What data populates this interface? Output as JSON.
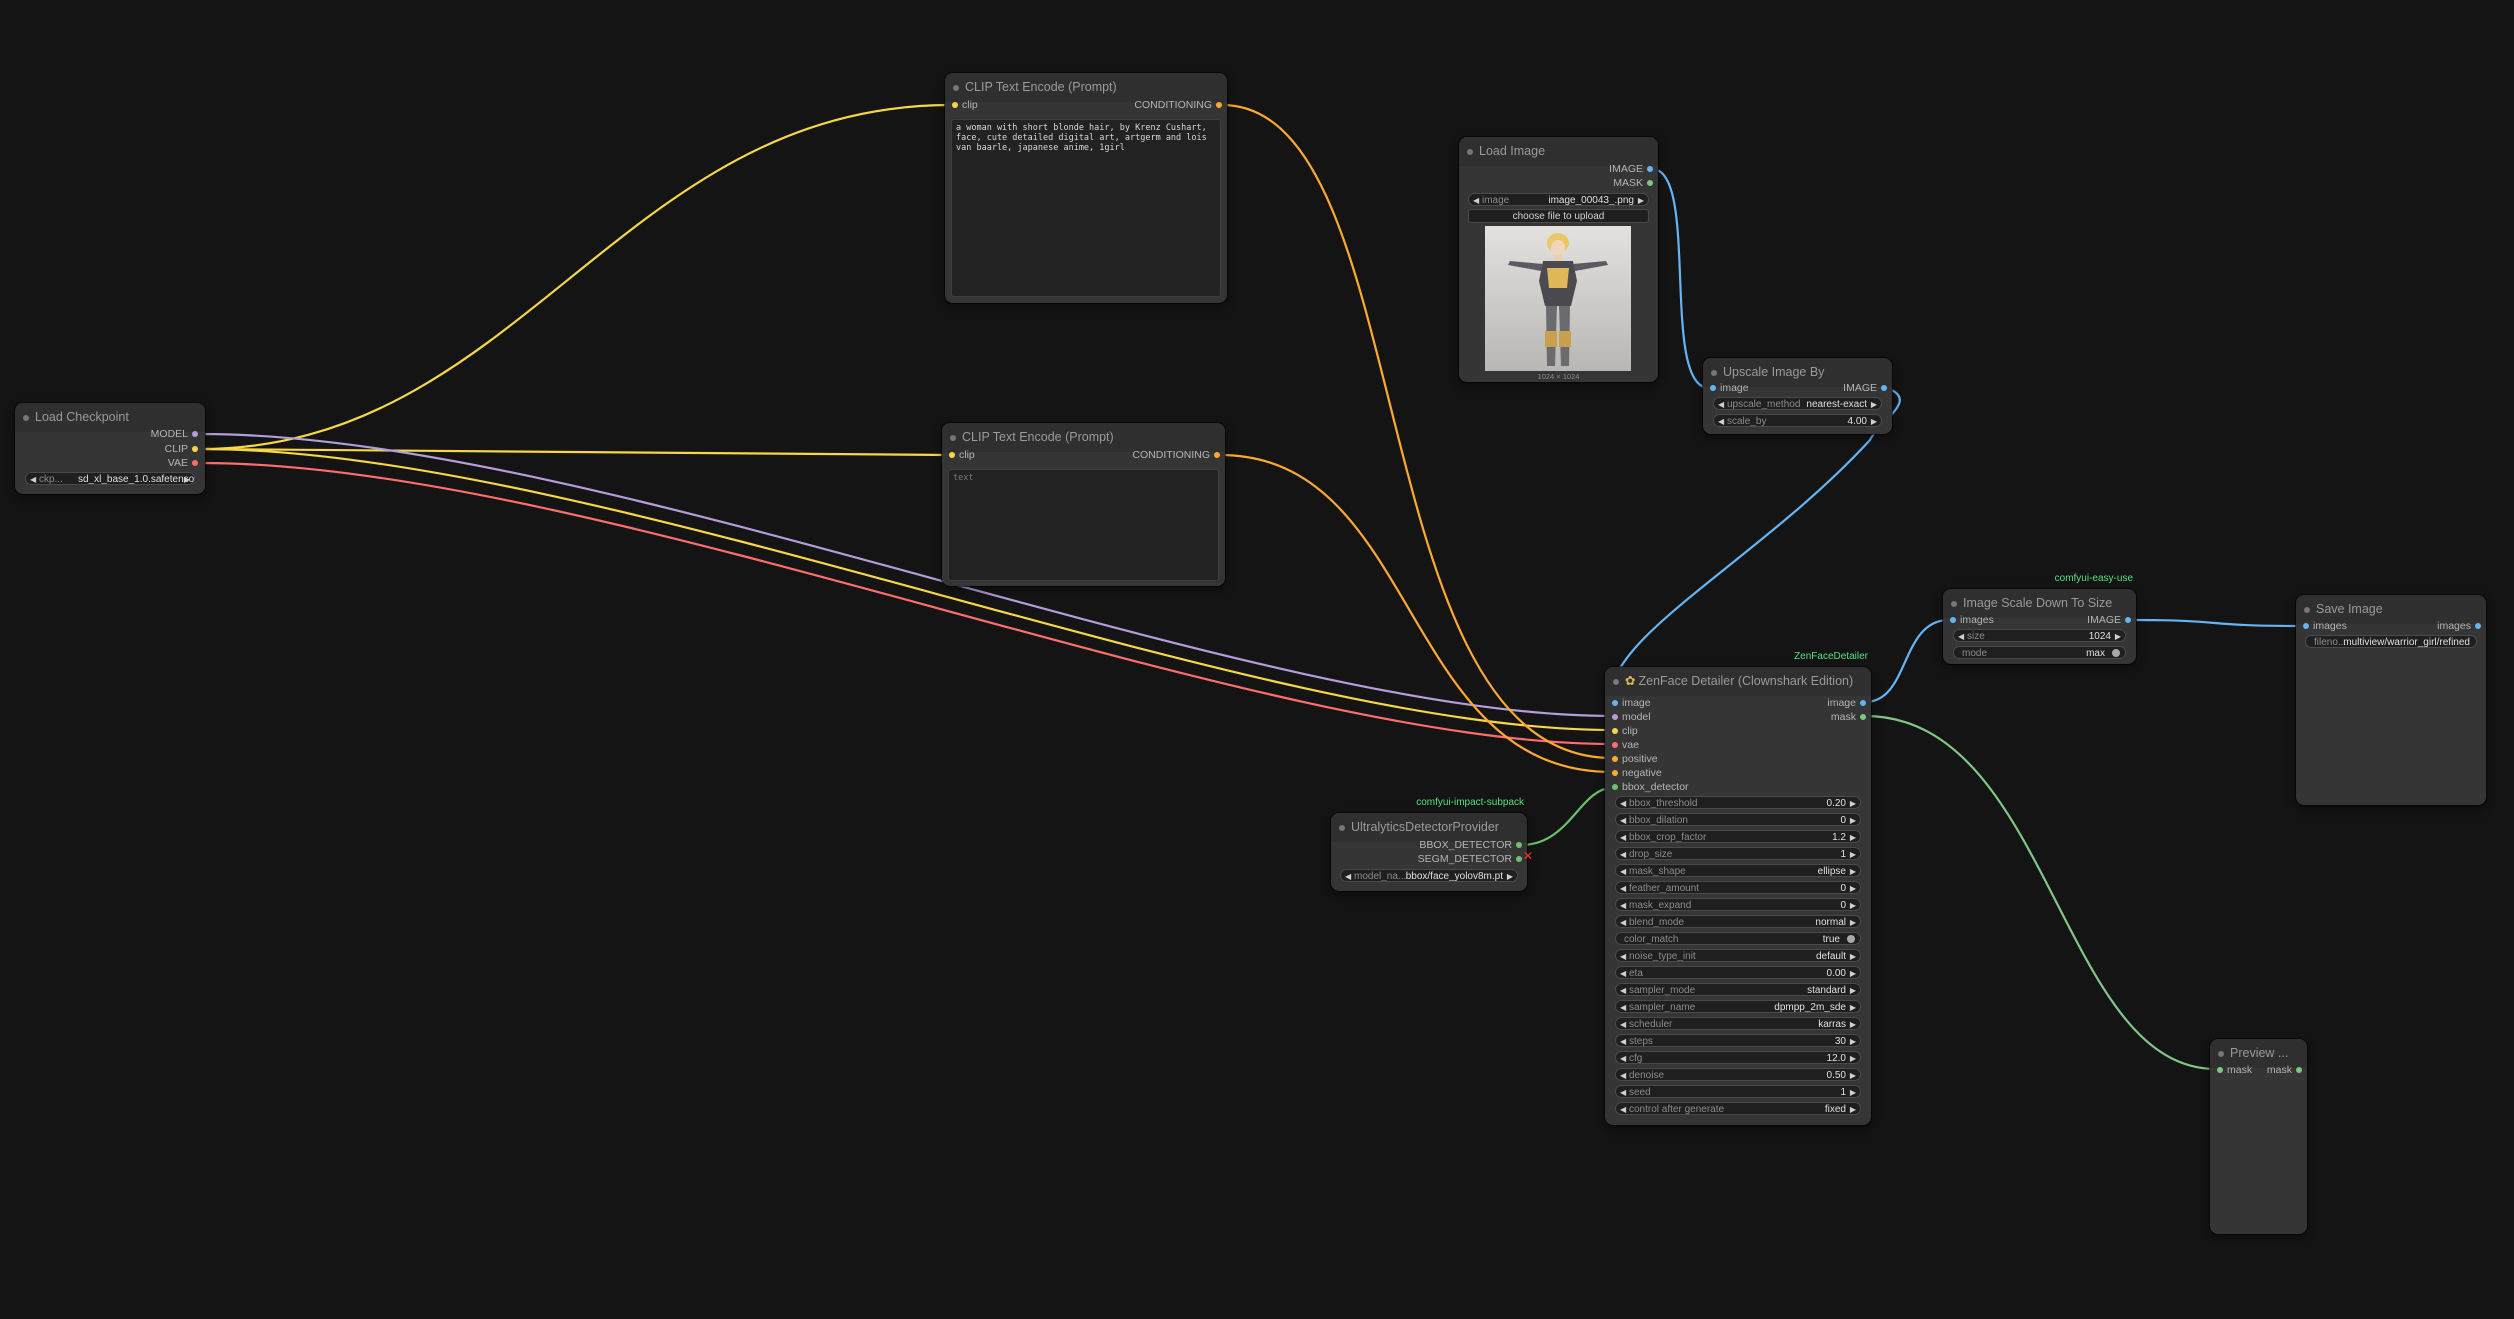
{
  "colors": {
    "clip": "#f7d648",
    "model": "#b39ddb",
    "vae": "#ff6e6e",
    "conditioning": "#ffa931",
    "image": "#64b5f6",
    "mask": "#81c784",
    "bbox": "#6cc16c",
    "badge": "#55e07b"
  },
  "load_checkpoint": {
    "title": "Load Checkpoint",
    "outputs": [
      "MODEL",
      "CLIP",
      "VAE"
    ],
    "ckpt_name": "ckp...",
    "ckpt_value": "sd_xl_base_1.0.safetensors"
  },
  "clip_encode_1": {
    "title": "CLIP Text Encode (Prompt)",
    "input": "clip",
    "output": "CONDITIONING",
    "text": "a woman with short blonde hair, by Krenz Cushart, face, cute detailed digital art, artgerm and lois van baarle, japanese anime, 1girl"
  },
  "clip_encode_2": {
    "title": "CLIP Text Encode (Prompt)",
    "input": "clip",
    "output": "CONDITIONING",
    "placeholder": "text"
  },
  "load_image": {
    "title": "Load Image",
    "outputs": [
      "IMAGE",
      "MASK"
    ],
    "image_label": "image",
    "image_value": "image_00043_.png",
    "upload_label": "choose file to upload",
    "caption": "1024 × 1024"
  },
  "upscale": {
    "title": "Upscale Image By",
    "input": "image",
    "output": "IMAGE",
    "widgets": [
      {
        "name": "upscale_method",
        "value": "nearest-exact"
      },
      {
        "name": "scale_by",
        "value": "4.00"
      }
    ]
  },
  "detector": {
    "badge": "comfyui-impact-subpack",
    "title": "UltralyticsDetectorProvider",
    "outputs": [
      "BBOX_DETECTOR",
      "SEGM_DETECTOR"
    ],
    "model_label": "model_na...",
    "model_value": "bbox/face_yolov8m.pt"
  },
  "zenface": {
    "badge": "ZenFaceDetailer",
    "title": "ZenFace Detailer (Clownshark Edition)",
    "inputs": [
      "image",
      "model",
      "clip",
      "vae",
      "positive",
      "negative",
      "bbox_detector"
    ],
    "outputs": [
      "image",
      "mask"
    ],
    "widgets": [
      {
        "name": "bbox_threshold",
        "value": "0.20"
      },
      {
        "name": "bbox_dilation",
        "value": "0"
      },
      {
        "name": "bbox_crop_factor",
        "value": "1.2"
      },
      {
        "name": "drop_size",
        "value": "1"
      },
      {
        "name": "mask_shape",
        "value": "ellipse"
      },
      {
        "name": "feather_amount",
        "value": "0"
      },
      {
        "name": "mask_expand",
        "value": "0"
      },
      {
        "name": "blend_mode",
        "value": "normal"
      },
      {
        "name": "color_match",
        "value": "true",
        "toggle": true
      },
      {
        "name": "noise_type_init",
        "value": "default"
      },
      {
        "name": "eta",
        "value": "0.00"
      },
      {
        "name": "sampler_mode",
        "value": "standard"
      },
      {
        "name": "sampler_name",
        "value": "dpmpp_2m_sde"
      },
      {
        "name": "scheduler",
        "value": "karras"
      },
      {
        "name": "steps",
        "value": "30"
      },
      {
        "name": "cfg",
        "value": "12.0"
      },
      {
        "name": "denoise",
        "value": "0.50"
      },
      {
        "name": "seed",
        "value": "1"
      },
      {
        "name": "control after generate",
        "value": "fixed"
      }
    ]
  },
  "scale_down": {
    "badge": "comfyui-easy-use",
    "title": "Image Scale Down To Size",
    "input": "images",
    "output": "IMAGE",
    "widgets": [
      {
        "name": "size",
        "value": "1024"
      },
      {
        "name": "mode",
        "value": "max",
        "toggle": true
      }
    ]
  },
  "save_image": {
    "title": "Save Image",
    "input": "images",
    "output": "images",
    "filename_label": "fileno...",
    "filename_value": "multiview/warrior_girl/refined"
  },
  "preview": {
    "title": "Preview ...",
    "input": "mask",
    "output": "mask"
  }
}
